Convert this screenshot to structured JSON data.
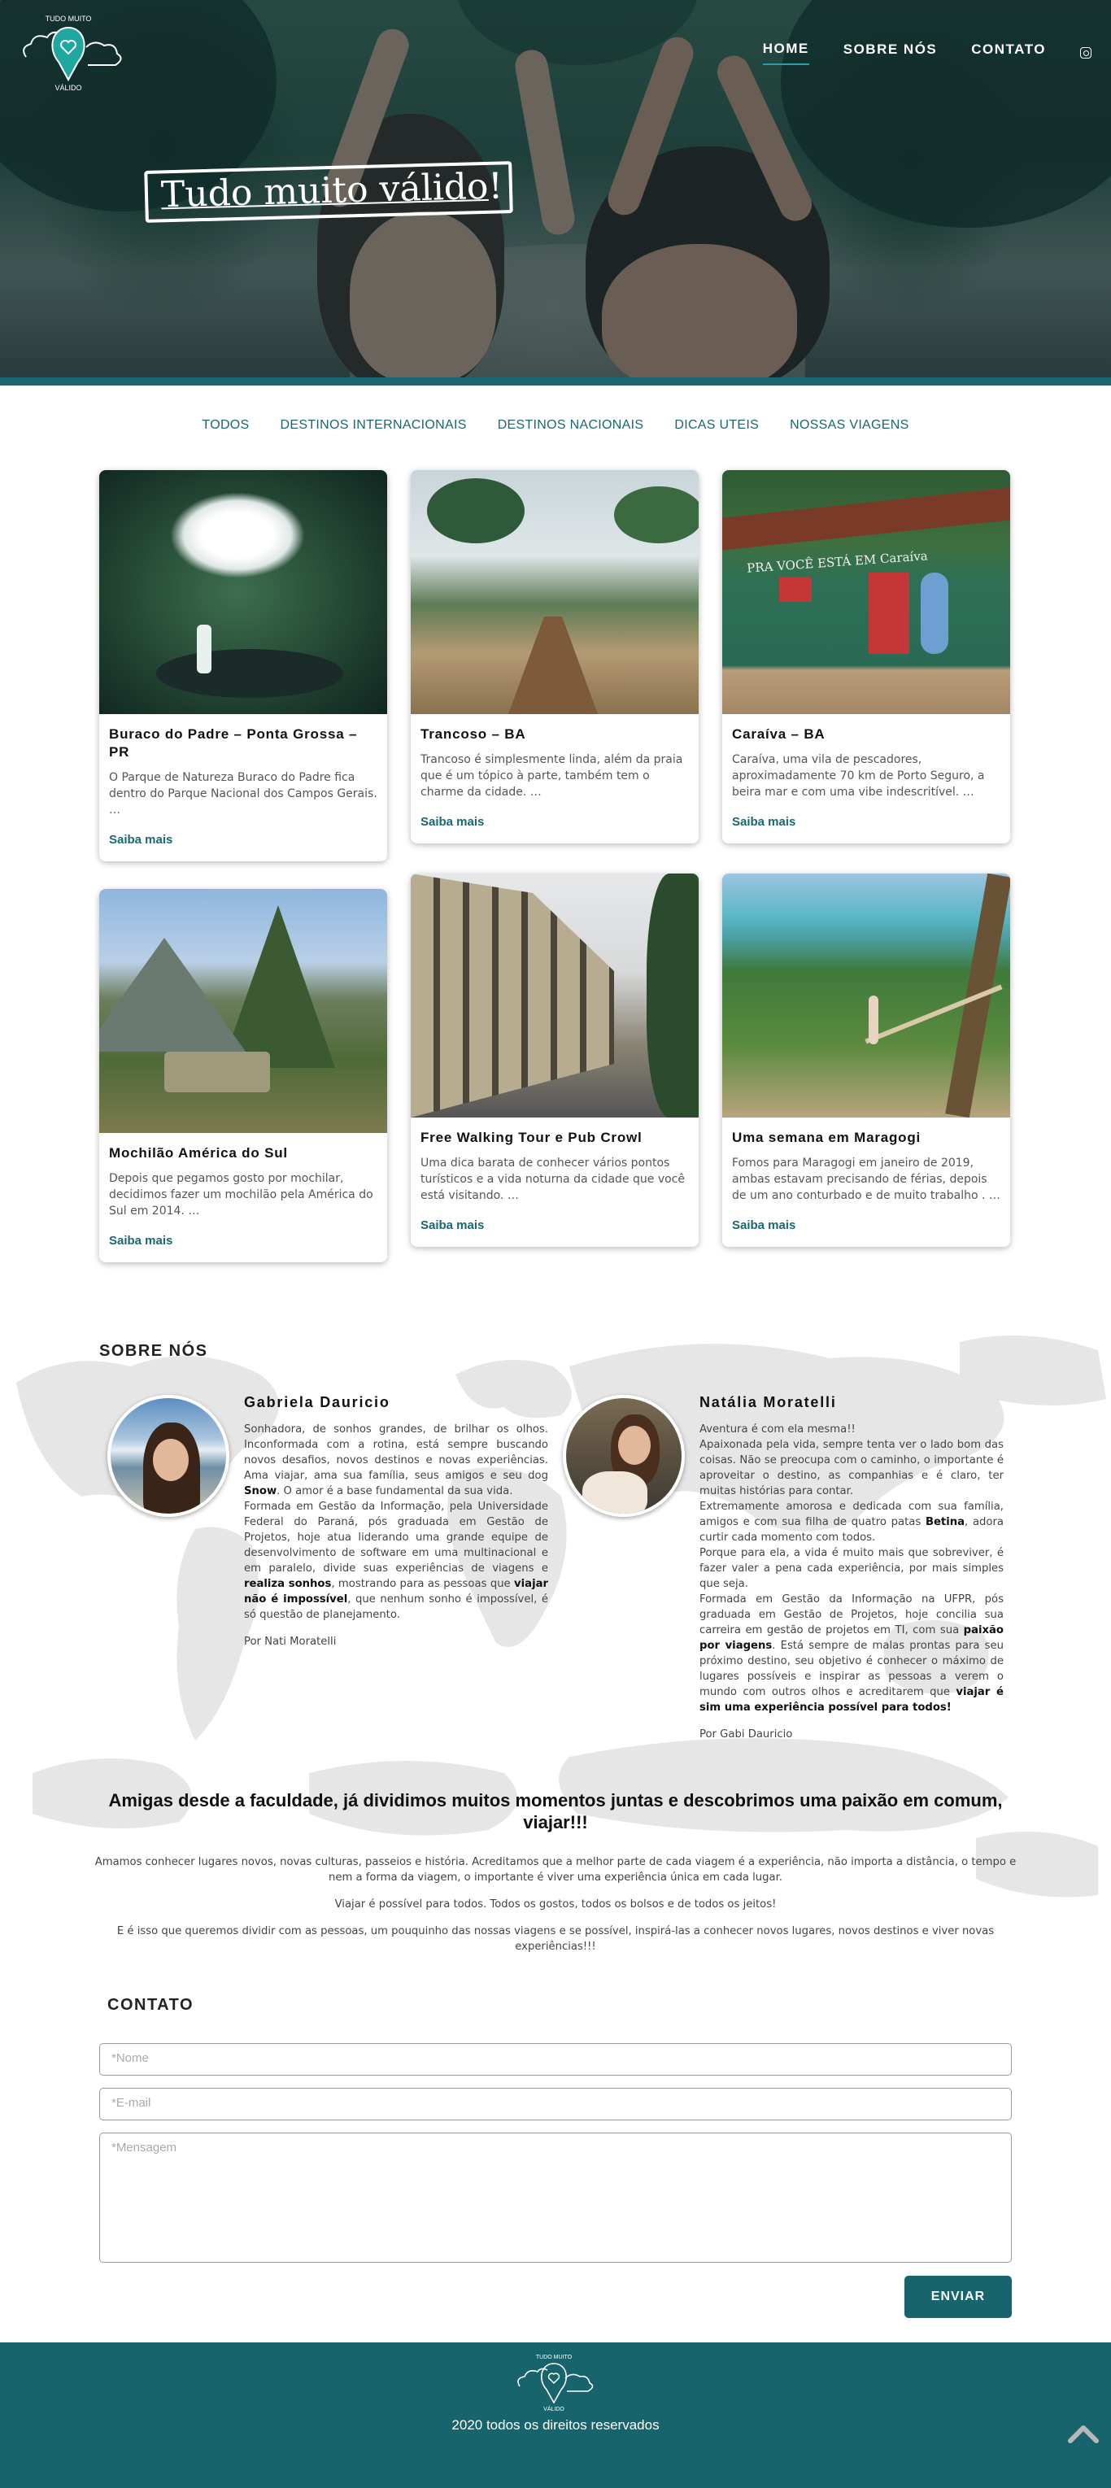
{
  "logo": {
    "line1": "TUDO MUITO",
    "line2": "VÁLIDO"
  },
  "nav": {
    "items": [
      {
        "label": "HOME",
        "active": true
      },
      {
        "label": "SOBRE NÓS",
        "active": false
      },
      {
        "label": "CONTATO",
        "active": false
      }
    ],
    "instagram_icon": "instagram-icon"
  },
  "hero": {
    "title": "Tudo muito válido",
    "title_end": "!"
  },
  "filters": [
    "TODOS",
    "DESTINOS INTERNACIONAIS",
    "DESTINOS NACIONAIS",
    "DICAS UTEIS",
    "NOSSAS VIAGENS"
  ],
  "cards": [
    {
      "title": "Buraco do Padre – Ponta Grossa – PR",
      "excerpt": "O Parque de Natureza Buraco do Padre fica dentro do Parque Nacional dos Campos Gerais. …",
      "link": "Saiba mais"
    },
    {
      "title": "Trancoso – BA",
      "excerpt": "Trancoso é simplesmente linda, além da praia que é um tópico à parte, também tem o charme da cidade. …",
      "link": "Saiba mais"
    },
    {
      "title": "Caraíva – BA",
      "excerpt": "Caraíva, uma vila de pescadores, aproximadamente 70 km de Porto Seguro, a beira mar e com uma vibe indescritível. …",
      "link": "Saiba mais"
    },
    {
      "title": "Mochilão América do Sul",
      "excerpt": "Depois que pegamos gosto por mochilar, decidimos fazer um mochilão pela América do Sul em 2014. …",
      "link": "Saiba mais"
    },
    {
      "title": "Free Walking Tour e Pub Crowl",
      "excerpt": "Uma dica barata de conhecer vários pontos turísticos e a vida noturna da cidade que você está visitando. …",
      "link": "Saiba mais"
    },
    {
      "title": "Uma semana em Maragogi",
      "excerpt": "Fomos para Maragogi em janeiro de 2019, ambas estavam precisando de férias, depois de um ano conturbado e de muito trabalho . …",
      "link": "Saiba mais"
    }
  ],
  "caraiva_sign": "PRA VOCÊ ESTÁ EM Caraíva",
  "sobre": {
    "heading": "SOBRE NÓS",
    "gabriela": {
      "name": "Gabriela Dauricio",
      "p1a": "Sonhadora, de sonhos grandes, de brilhar os olhos. Inconformada com a rotina, está sempre buscando novos desafios, novos destinos e novas experiências. Ama viajar, ama sua família, seus amigos e seu dog ",
      "p1b": "Snow",
      "p1c": ". O amor é a base fundamental da sua vida.",
      "p2a": "Formada em Gestão da Informação, pela Universidade Federal do Paraná, pós graduada em Gestão de Projetos, hoje atua liderando uma grande equipe de desenvolvimento de software em uma multinacional e em paralelo, divide suas experiências de viagens e ",
      "p2b": "realiza sonhos",
      "p2c": ", mostrando para as pessoas que ",
      "p2d": "viajar não é impossível",
      "p2e": ", que nenhum sonho é impossível, é só questão de planejamento.",
      "by": "Por Nati Moratelli"
    },
    "natalia": {
      "name": "Natália Moratelli",
      "l1": "Aventura é com ela mesma!!",
      "l2": "Apaixonada pela vida, sempre tenta ver o lado bom das coisas. Não se preocupa com o caminho, o importante é aproveitar o destino, as companhias e é claro, ter muitas histórias para contar.",
      "l3a": "Extremamente amorosa e dedicada com sua família, amigos e com sua filha de quatro patas ",
      "l3b": "Betina",
      "l3c": ", adora curtir cada momento com todos.",
      "l4": "Porque para ela, a vida é muito mais que sobreviver, é fazer valer a pena cada experiência, por mais simples que seja.",
      "l5a": "Formada em Gestão da Informação na UFPR, pós graduada em Gestão de Projetos, hoje concilia sua carreira em gestão de projetos em TI, com sua ",
      "l5b": "paixão por viagens",
      "l5c": ". Está sempre de malas prontas para seu próximo destino, seu objetivo é conhecer o máximo de lugares possíveis e inspirar as pessoas a verem o mundo com outros olhos e acreditarem que ",
      "l5d": "viajar é sim uma experiência possível para todos!",
      "by": "Por Gabi Dauricio"
    },
    "amigas_title": "Amigas desde a faculdade, já dividimos muitos momentos juntas e descobrimos uma paixão em comum, viajar!!!",
    "amigas_p1": "Amamos conhecer lugares novos, novas culturas, passeios e história. Acreditamos que a melhor parte de cada viagem é a experiência, não importa a distância, o tempo e nem a forma da viagem, o importante é viver uma experiência única em cada lugar.",
    "amigas_p2": "Viajar é possível para todos. Todos os gostos, todos os bolsos e de todos os jeitos!",
    "amigas_p3": "E é isso que queremos dividir com as pessoas, um pouquinho das nossas viagens e se possível, inspirá-las a conhecer novos lugares, novos destinos e viver novas experiências!!!"
  },
  "contato": {
    "heading": "CONTATO",
    "name_placeholder": "*Nome",
    "email_placeholder": "*E-mail",
    "message_placeholder": "*Mensagem",
    "send_label": "ENVIAR"
  },
  "footer": {
    "copyright": "2020 todos os direitos reservados",
    "logo_line1": "TUDO MUITO",
    "logo_line2": "VÁLIDO"
  }
}
